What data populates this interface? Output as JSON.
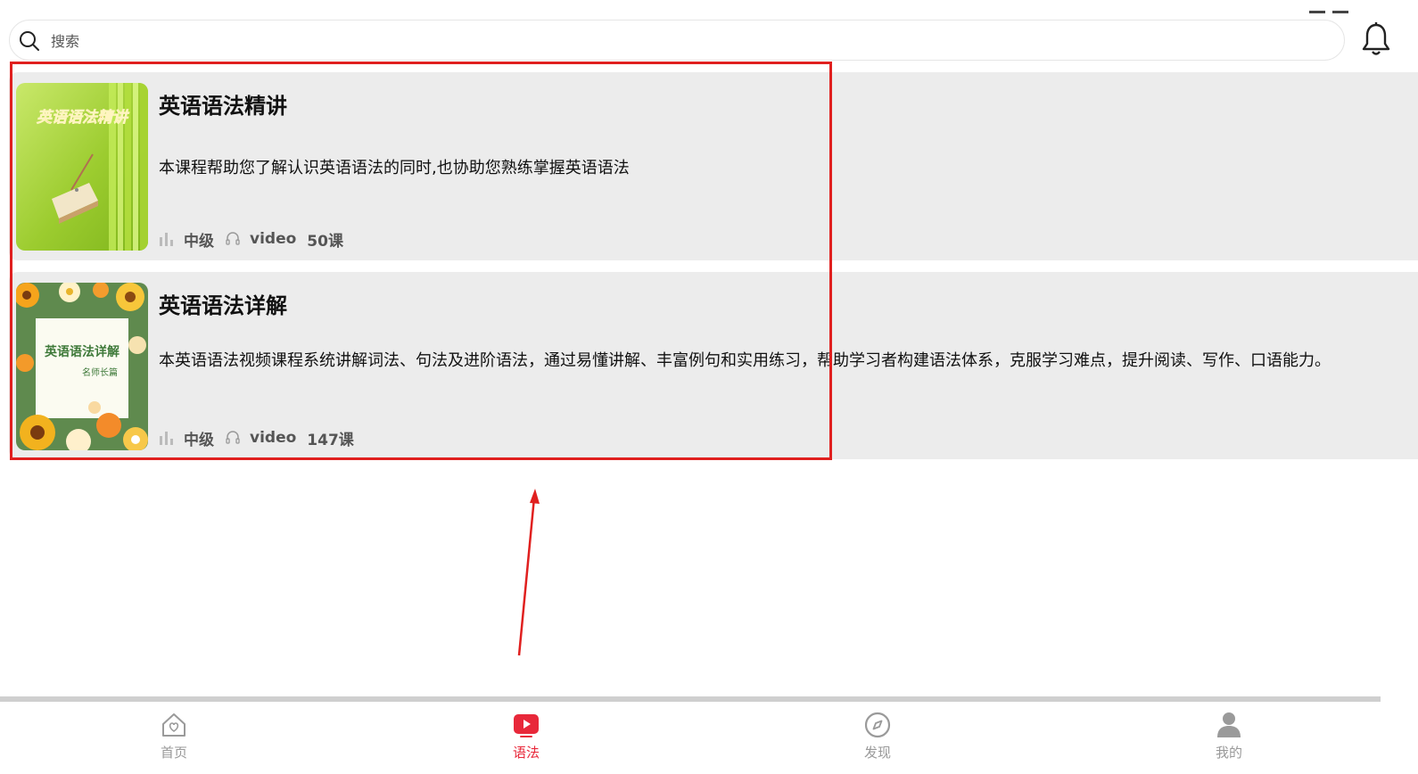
{
  "search": {
    "placeholder": "搜索"
  },
  "courses": [
    {
      "cover_text": "英语语法精讲",
      "title": "英语语法精讲",
      "desc": "本课程帮助您了解认识英语语法的同时,也协助您熟练掌握英语语法",
      "level": "中级",
      "type": "video",
      "count": "50课"
    },
    {
      "cover_text": "英语语法详解",
      "cover_sub": "名师长篇",
      "title": "英语语法详解",
      "desc": "本英语语法视频课程系统讲解词法、句法及进阶语法，通过易懂讲解、丰富例句和实用练习，帮助学习者构建语法体系，克服学习难点，提升阅读、写作、口语能力。",
      "level": "中级",
      "type": "video",
      "count": "147课"
    }
  ],
  "tabs": [
    {
      "label": "首页",
      "icon": "home-icon",
      "active": false
    },
    {
      "label": "语法",
      "icon": "play-icon",
      "active": true
    },
    {
      "label": "发现",
      "icon": "compass-icon",
      "active": false
    },
    {
      "label": "我的",
      "icon": "user-icon",
      "active": false
    }
  ],
  "colors": {
    "accent": "#e8283a",
    "annotation": "#e0201f",
    "card_bg": "#ececec"
  }
}
